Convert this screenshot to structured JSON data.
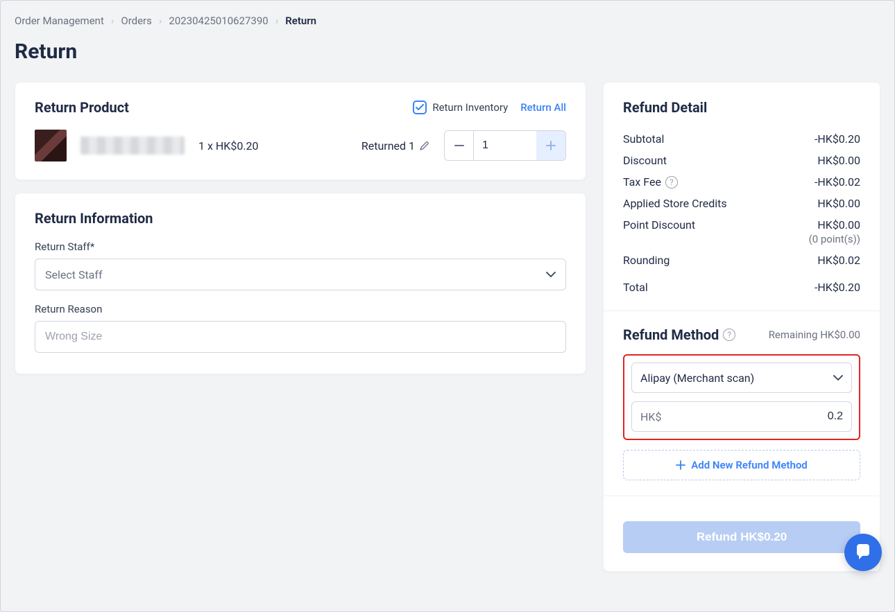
{
  "breadcrumb": {
    "items": [
      "Order Management",
      "Orders",
      "20230425010627390",
      "Return"
    ]
  },
  "page_title": "Return",
  "return_product": {
    "title": "Return Product",
    "return_inventory_label": "Return Inventory",
    "return_inventory_checked": true,
    "return_all_label": "Return All",
    "item": {
      "qty_price": "1 x HK$0.20",
      "returned_label": "Returned 1",
      "stepper_value": "1"
    }
  },
  "return_info": {
    "title": "Return Information",
    "staff_label": "Return Staff*",
    "staff_placeholder": "Select Staff",
    "reason_label": "Return Reason",
    "reason_placeholder": "Wrong Size"
  },
  "refund_detail": {
    "title": "Refund Detail",
    "rows": {
      "subtotal": {
        "label": "Subtotal",
        "value": "-HK$0.20"
      },
      "discount": {
        "label": "Discount",
        "value": "HK$0.00"
      },
      "tax_fee": {
        "label": "Tax Fee",
        "value": "-HK$0.02"
      },
      "applied_credits": {
        "label": "Applied Store Credits",
        "value": "HK$0.00"
      },
      "point_discount": {
        "label": "Point Discount",
        "value": "HK$0.00",
        "sub": "(0 point(s))"
      },
      "rounding": {
        "label": "Rounding",
        "value": "HK$0.02"
      },
      "total": {
        "label": "Total",
        "value": "-HK$0.20"
      }
    }
  },
  "refund_method": {
    "title": "Refund Method",
    "remaining": "Remaining HK$0.00",
    "selected_method": "Alipay (Merchant scan)",
    "currency_prefix": "HK$",
    "amount": "0.2",
    "add_label": "Add New Refund Method"
  },
  "refund_button": "Refund HK$0.20"
}
